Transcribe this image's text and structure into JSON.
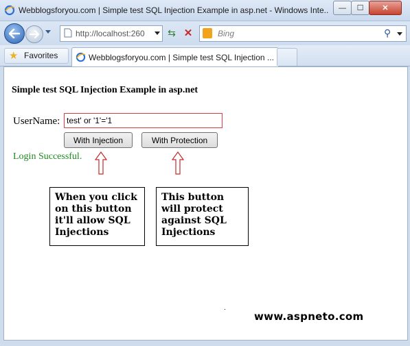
{
  "window": {
    "title": "Webblogsforyou.com | Simple test SQL Injection Example in asp.net - Windows Inte...",
    "controls": {
      "minimize": "—",
      "maximize": "☐",
      "close": "✕"
    }
  },
  "nav": {
    "address": "http://localhost:260",
    "search_placeholder": "Bing"
  },
  "favorites": {
    "favorites_label": "Favorites",
    "tab_label": "Webblogsforyou.com | Simple test SQL Injection ..."
  },
  "page": {
    "heading": "Simple test SQL Injection Example in asp.net",
    "username_label": "UserName:",
    "username_value": "test' or '1'='1",
    "btn_injection": "With Injection",
    "btn_protection": "With Protection",
    "result": "Login Successful.",
    "note_injection": "When you click on this button it'll allow SQL Injections",
    "note_protection": "This button will protect against SQL Injections",
    "watermark": "www.aspneto.com"
  },
  "colors": {
    "result_text": "#1c8a1c",
    "input_border": "#e03c3c",
    "arrow_stroke": "#c62828"
  },
  "icons": [
    "ie-icon",
    "back-arrow-icon",
    "forward-arrow-icon",
    "page-icon",
    "refresh-icon",
    "stop-icon",
    "bing-icon",
    "search-icon",
    "star-icon",
    "up-arrow-icon"
  ]
}
